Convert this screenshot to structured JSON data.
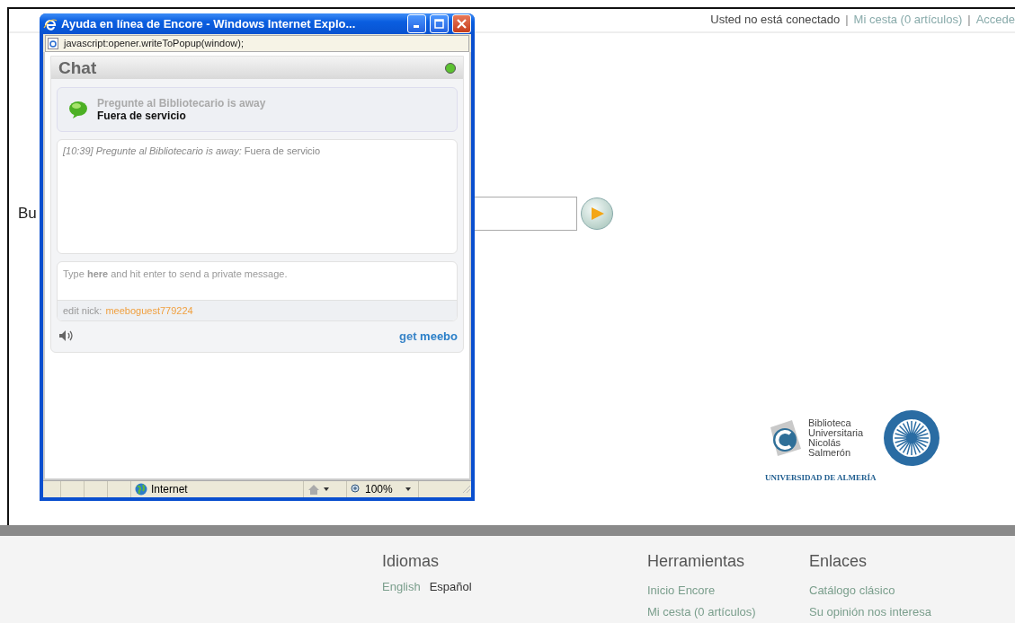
{
  "page": {
    "user_links": [
      {
        "kind": "text",
        "text": "Usted no está conectado"
      },
      {
        "kind": "separator",
        "text": "|"
      },
      {
        "kind": "link",
        "text": "Mi cesta (0 artículos)"
      },
      {
        "kind": "separator",
        "text": "|"
      },
      {
        "kind": "link",
        "text": "Accede"
      }
    ],
    "search_label": "Bu",
    "logo": {
      "lines": [
        "Biblioteca",
        "Universitaria",
        "Nicolás",
        "Salmerón"
      ],
      "university": "UNIVERSIDAD DE ALMERÍA"
    },
    "footer": [
      {
        "heading": "Idiomas",
        "kind": "inline",
        "links": [
          {
            "text": "English",
            "selected": false
          },
          {
            "text": "Español",
            "selected": true
          }
        ]
      },
      {
        "heading": "Herramientas",
        "kind": "stacked",
        "links": [
          {
            "text": "Inicio Encore",
            "selected": false
          },
          {
            "text": "Mi cesta (0 artículos)",
            "selected": false
          }
        ]
      },
      {
        "heading": "Enlaces",
        "kind": "stacked",
        "links": [
          {
            "text": "Catálogo clásico",
            "selected": false
          },
          {
            "text": "Su opinión nos interesa",
            "selected": false
          }
        ]
      }
    ]
  },
  "popup": {
    "title": "Ayuda en línea de Encore - Windows Internet Explo...",
    "address": "javascript:opener.writeToPopup(window);",
    "chat": {
      "header": "Chat",
      "online": true,
      "status_name": "Pregunte al Bibliotecario is away",
      "status_message": "Fuera de servicio",
      "messages": [
        {
          "time": "[10:39]",
          "sender": "Pregunte al Bibliotecario is away:",
          "text": "Fuera de servicio"
        }
      ],
      "input_hint": "Type **here** and hit enter to send a private message.",
      "nick_label": "edit nick:",
      "nick": "meeboguest779224",
      "brand_prefix": "get",
      "brand": "meebo"
    },
    "status_bar": {
      "zone": "Internet",
      "zoom": "100%"
    }
  }
}
